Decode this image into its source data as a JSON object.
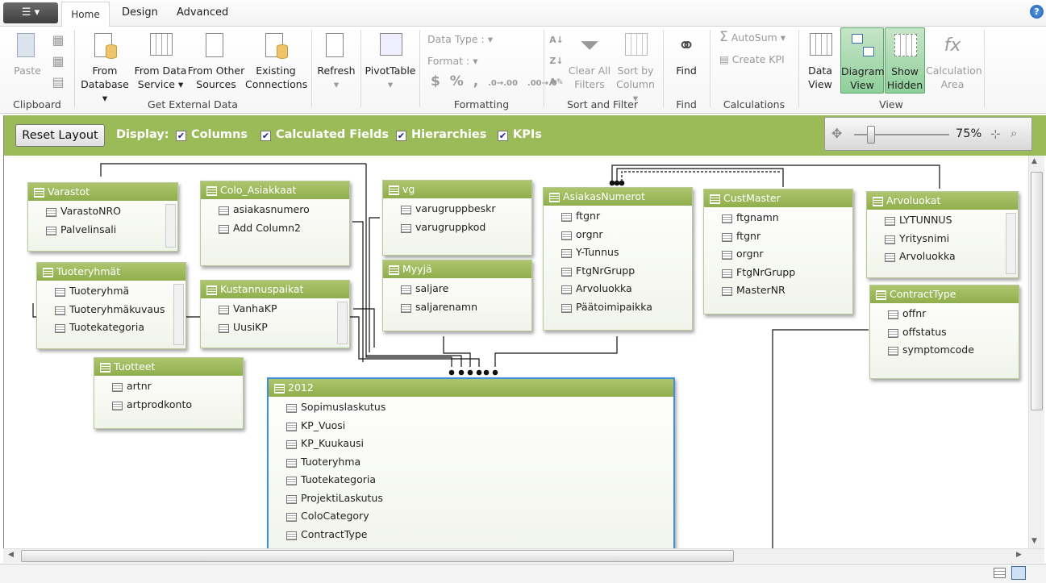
{
  "tabs": [
    "Home",
    "Design",
    "Advanced"
  ],
  "ribbon": {
    "clipboard": {
      "paste": "Paste",
      "group": "Clipboard"
    },
    "external": {
      "from_database": [
        "From",
        "Database"
      ],
      "from_data_service": [
        "From Data",
        "Service"
      ],
      "from_other": [
        "From Other",
        "Sources"
      ],
      "existing": [
        "Existing",
        "Connections"
      ],
      "group": "Get External Data"
    },
    "refresh": "Refresh",
    "pivottable": "PivotTable",
    "formatting": {
      "data_type": "Data Type :",
      "format": "Format :",
      "symbols": [
        "$",
        "%",
        ",",
        ".0→.00",
        ".00→.0"
      ],
      "group": "Formatting"
    },
    "sort": {
      "clear_all": [
        "Clear All",
        "Filters"
      ],
      "sort_by": [
        "Sort by",
        "Column"
      ],
      "group": "Sort and Filter"
    },
    "find": {
      "label": "Find",
      "group": "Find"
    },
    "calc": {
      "autosum": "AutoSum",
      "create_kpi": "Create KPI",
      "group": "Calculations"
    },
    "view": {
      "data_view": [
        "Data",
        "View"
      ],
      "diagram_view": [
        "Diagram",
        "View"
      ],
      "show_hidden": [
        "Show",
        "Hidden"
      ],
      "calc_area": [
        "Calculation",
        "Area"
      ],
      "group": "View"
    }
  },
  "display_bar": {
    "reset": "Reset Layout",
    "display": "Display:",
    "options": [
      {
        "label": "Columns",
        "checked": true
      },
      {
        "label": "Calculated Fields",
        "checked": true
      },
      {
        "label": "Hierarchies",
        "checked": true
      },
      {
        "label": "KPIs",
        "checked": true
      }
    ],
    "zoom": "75%",
    "zoom_value": 75
  },
  "tables": [
    {
      "name": "Varastot",
      "columns": [
        "VarastoNRO",
        "Palvelinsali"
      ]
    },
    {
      "name": "Colo_Asiakkaat",
      "columns": [
        "asiakasnumero",
        "Add Column2"
      ]
    },
    {
      "name": "vg",
      "columns": [
        "varugruppbeskr",
        "varugruppkod"
      ]
    },
    {
      "name": "AsiakasNumerot",
      "columns": [
        "ftgnr",
        "orgnr",
        "Y-Tunnus",
        "FtgNrGrupp",
        "Arvoluokka",
        "Päätoimipaikka"
      ]
    },
    {
      "name": "CustMaster",
      "columns": [
        "ftgnamn",
        "ftgnr",
        "orgnr",
        "FtgNrGrupp",
        "MasterNR"
      ]
    },
    {
      "name": "Arvoluokat",
      "columns": [
        "LYTUNNUS",
        "Yritysnimi",
        "Arvoluokka"
      ]
    },
    {
      "name": "Tuoteryhmät",
      "columns": [
        "Tuoteryhmä",
        "Tuoteryhmäkuvaus",
        "Tuotekategoria"
      ]
    },
    {
      "name": "Kustannuspaikat",
      "columns": [
        "VanhaKP",
        "UusiKP"
      ]
    },
    {
      "name": "Myyjä",
      "columns": [
        "saljare",
        "saljarenamn"
      ]
    },
    {
      "name": "ContractType",
      "columns": [
        "offnr",
        "offstatus",
        "symptomcode"
      ]
    },
    {
      "name": "Tuotteet",
      "columns": [
        "artnr",
        "artprodkonto"
      ]
    },
    {
      "name": "2012",
      "columns": [
        "Sopimuslaskutus",
        "KP_Vuosi",
        "KP_Kuukausi",
        "Tuoteryhma",
        "Tuotekategoria",
        "ProjektiLaskutus",
        "ColoCategory",
        "ContractType"
      ],
      "selected": true
    }
  ]
}
